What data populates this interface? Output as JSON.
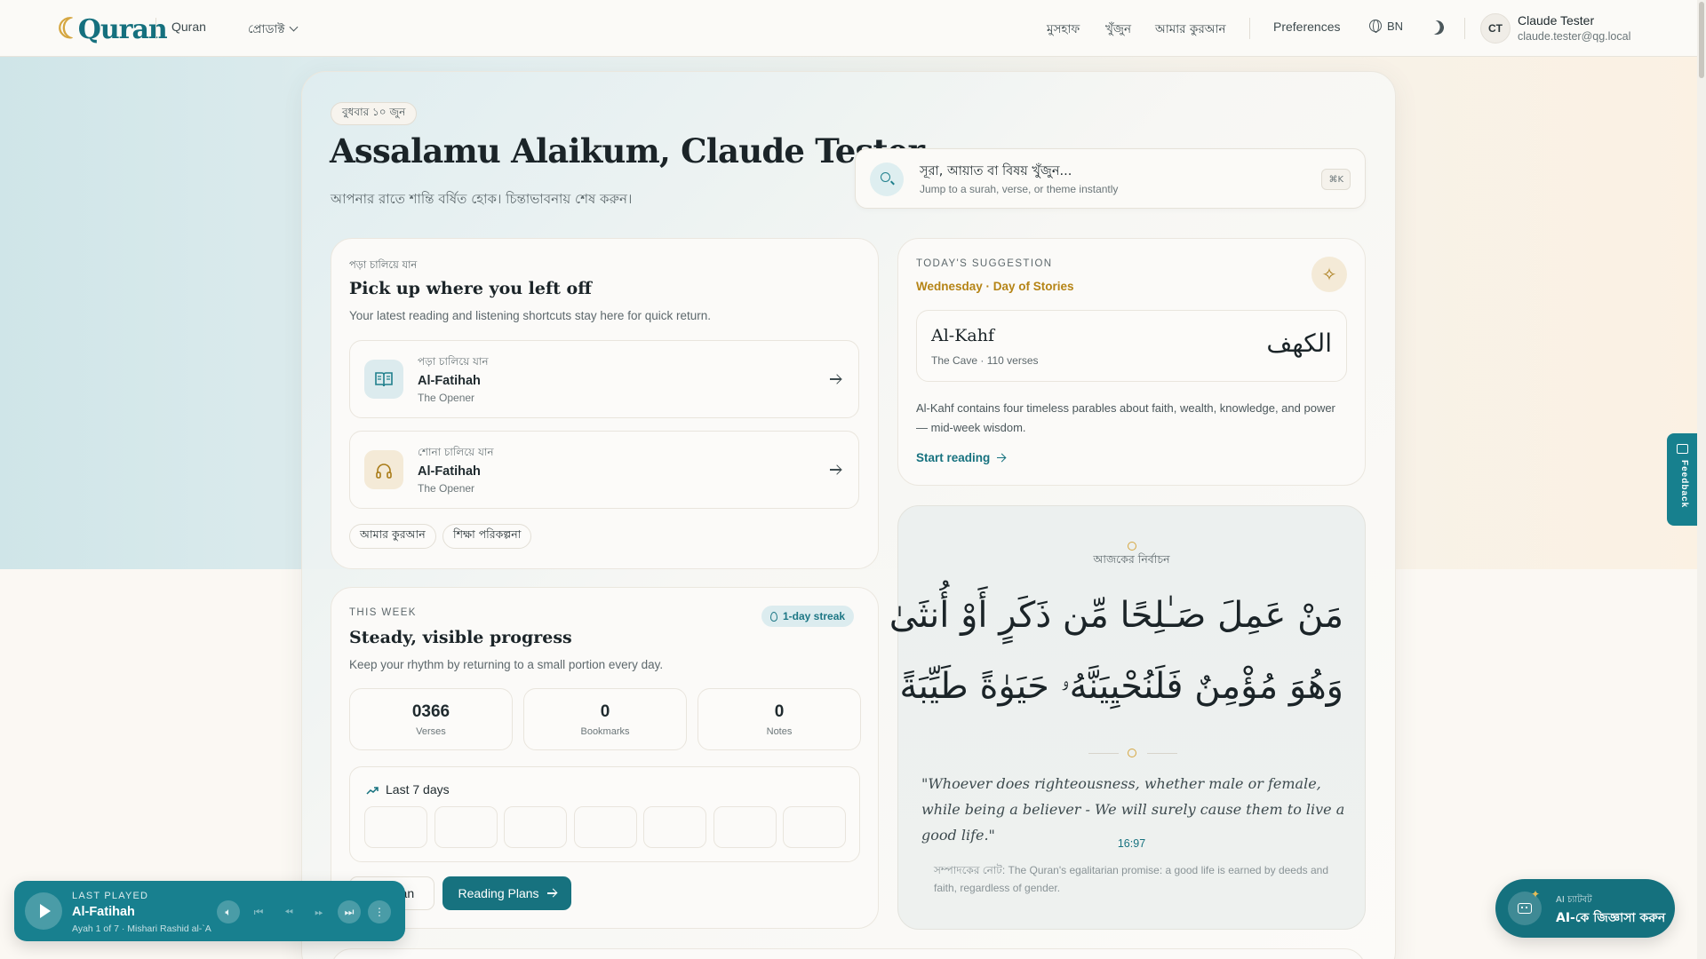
{
  "nav": {
    "brand": "Quran",
    "brand_sub": "Quran",
    "products": "প্রোডাক্ট",
    "links": [
      "মুসহাফ",
      "খুঁজুন",
      "আমার কুরআন"
    ],
    "preferences": "Preferences",
    "language": "BN",
    "user_initials": "CT",
    "user_name": "Claude Tester",
    "user_email": "claude.tester@qg.local"
  },
  "hero": {
    "date": "বুধবার ১০ জুন",
    "greeting": "Assalamu Alaikum, Claude Tester",
    "subtitle": "আপনার রাতে শান্তি বর্ষিত হোক। চিন্তাভাবনায় শেষ করুন।",
    "search_placeholder": "সূরা, আয়াত বা বিষয় খুঁজুন...",
    "search_sub": "Jump to a surah, verse, or theme instantly",
    "search_shortcut": "⌘K"
  },
  "continue": {
    "eyebrow": "পড়া চালিয়ে যান",
    "title": "Pick up where you left off",
    "desc": "Your latest reading and listening shortcuts stay here for quick return.",
    "items": [
      {
        "label": "পড়া চালিয়ে যান",
        "surah": "Al-Fatihah",
        "sub": "The Opener"
      },
      {
        "label": "শোনা চালিয়ে যান",
        "surah": "Al-Fatihah",
        "sub": "The Opener"
      }
    ],
    "chips": [
      "আমার কুরআন",
      "শিক্ষা পরিকল্পনা"
    ]
  },
  "week": {
    "eyebrow": "THIS WEEK",
    "title": "Steady, visible progress",
    "desc": "Keep your rhythm by returning to a small portion every day.",
    "streak": "1-day streak",
    "stats": [
      {
        "value": "0366",
        "label": "Verses"
      },
      {
        "value": "0",
        "label": "Bookmarks"
      },
      {
        "value": "0",
        "label": "Notes"
      }
    ],
    "last7": "Last 7 days",
    "ghost_btn": "ran",
    "primary_btn": "Reading Plans"
  },
  "suggestion": {
    "eyebrow": "TODAY'S SUGGESTION",
    "date": "Wednesday · Day of Stories",
    "surah_name": "Al-Kahf",
    "surah_meta": "The Cave · 110 verses",
    "surah_arabic": "الكهف",
    "text": "Al-Kahf contains four timeless parables about faith, wealth, knowledge, and power — mid-week wisdom.",
    "cta": "Start reading"
  },
  "verse": {
    "label": "আজকের নির্বাচন",
    "arabic_line1": "مَنْ عَمِلَ صَـٰلِحًا مِّن ذَكَرٍ أَوْ أُنثَىٰ",
    "arabic_line2": "وَهُوَ مُؤْمِنٌ فَلَنُحْيِيَنَّهُۥ حَيَوٰةً طَيِّبَةً",
    "translation": "\"Whoever does righteousness, whether male or female, while being a believer - We will surely cause them to live a good life.\"",
    "reference": "16:97",
    "note": "সম্পাদকের নোট: The Quran's egalitarian promise: a good life is earned by deeds and faith, regardless of gender."
  },
  "player": {
    "eyebrow": "LAST PLAYED",
    "title": "Al-Fatihah",
    "sub": "Ayah 1 of 7 · Mishari Rashid al-`A"
  },
  "ai": {
    "small": "AI চ্যাটবট",
    "main": "AI-কে জিজ্ঞাসা করুন"
  },
  "feedback": "Feedback",
  "colors": {
    "accent": "#17727f",
    "gold": "#b58416",
    "background": "#fbf8f3"
  }
}
